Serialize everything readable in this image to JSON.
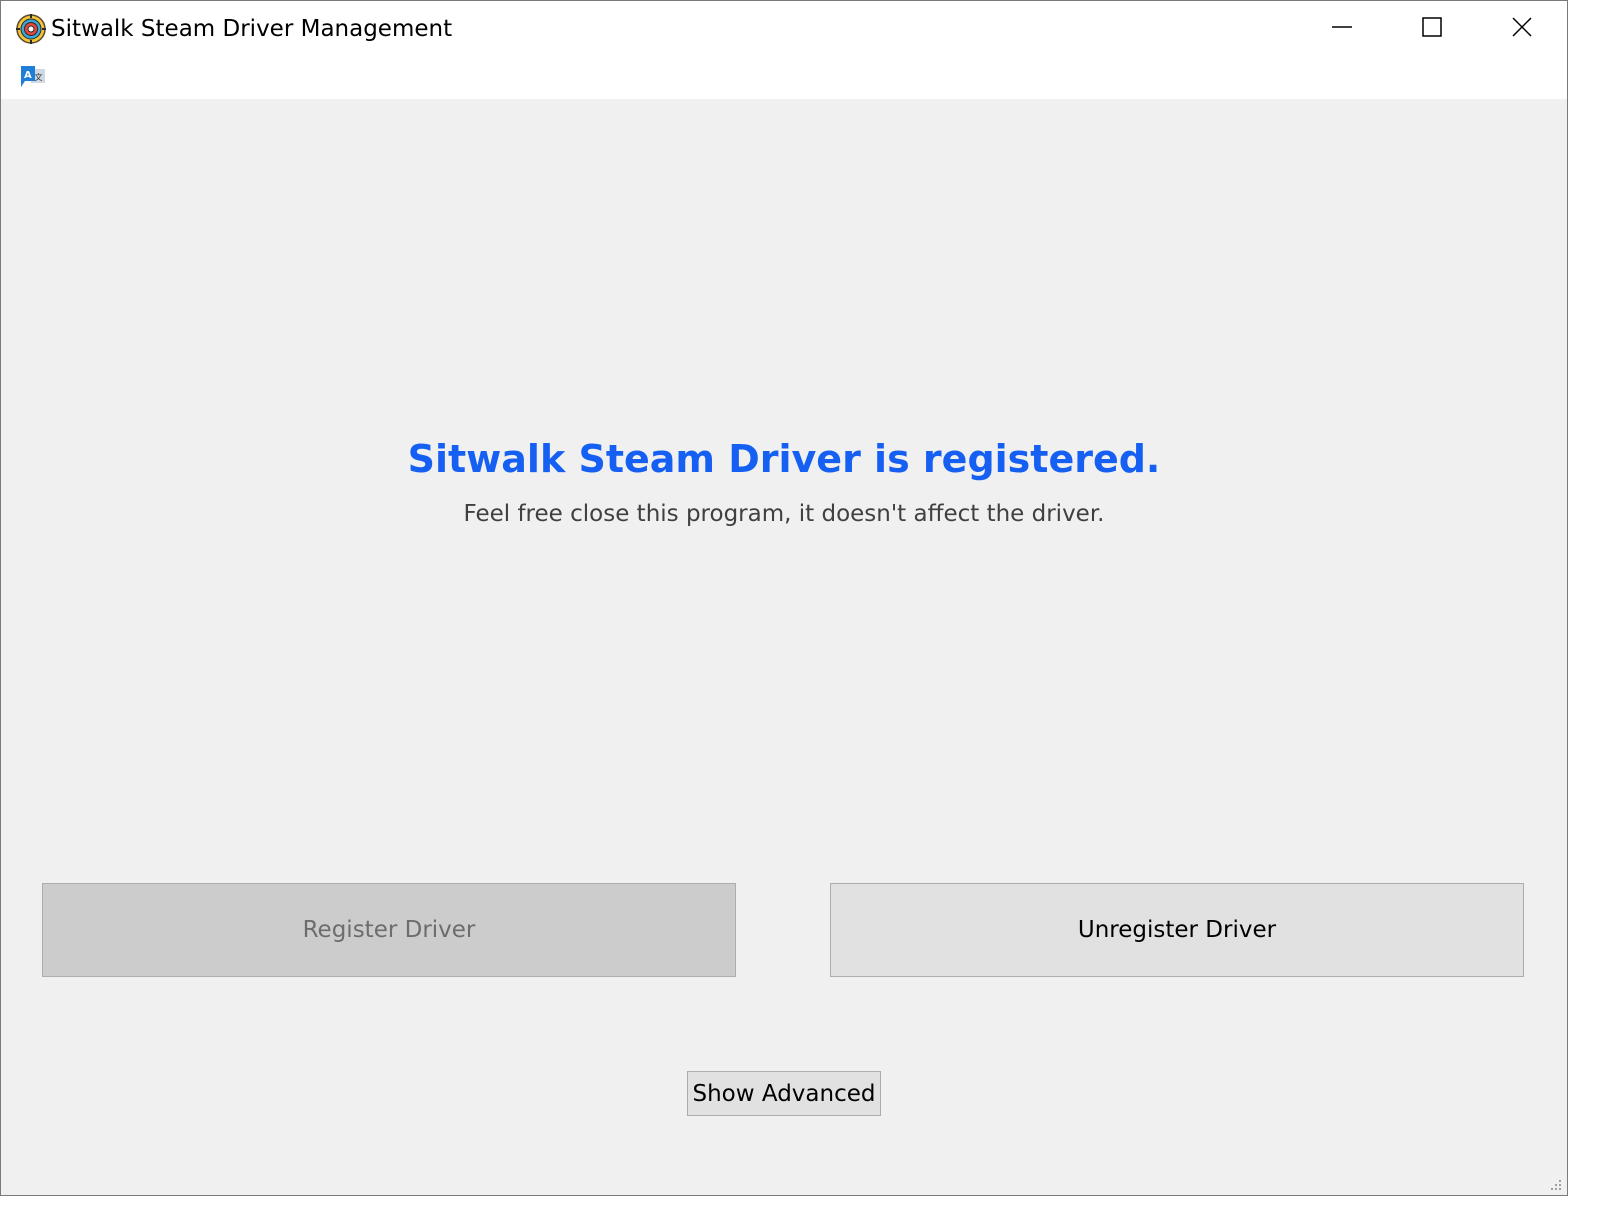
{
  "window": {
    "title": "Sitwalk Steam Driver Management",
    "icon": "app-gear-icon",
    "controls": {
      "minimize": "minimize-icon",
      "maximize": "maximize-icon",
      "close": "close-icon"
    }
  },
  "toolbar": {
    "language_icon": "translate-icon"
  },
  "status": {
    "heading": "Sitwalk Steam Driver is registered.",
    "message": "Feel free close this program, it doesn't affect the driver."
  },
  "actions": {
    "register_label": "Register Driver",
    "unregister_label": "Unregister Driver",
    "show_advanced_label": "Show Advanced"
  },
  "colors": {
    "heading": "#1560f2",
    "disabled_button": "#cccccc",
    "button": "#e1e1e1",
    "background": "#f0f0f0"
  }
}
